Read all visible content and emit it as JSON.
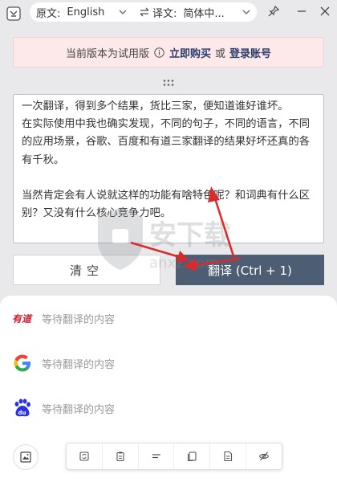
{
  "header": {
    "source_label": "原文:",
    "source_value": "English",
    "target_label": "译文:",
    "target_value": "简体中..."
  },
  "trial": {
    "notice": "当前版本为试用版",
    "buy_link": "立即购买",
    "or": "或",
    "login_link": "登录账号"
  },
  "source_text": "一次翻译，得到多个结果，货比三家，便知道谁好谁坏。\n在实际使用中我也确实发现，不同的句子，不同的语言，不同的应用场景，谷歌、百度和有道三家翻译的结果好坏还真的各有千秋。\n\n当然肯定会有人说就这样的功能有啥特色呢？和词典有什么区别？又没有什么核心竞争力吧。",
  "buttons": {
    "clear": "清空",
    "translate": "翻译 (Ctrl + 1)"
  },
  "results": [
    {
      "engine": "youdao-icon",
      "placeholder": "等待翻译的内容"
    },
    {
      "engine": "google-icon",
      "placeholder": "等待翻译的内容"
    },
    {
      "engine": "baidu-icon",
      "placeholder": "等待翻译的内容"
    }
  ],
  "watermark": "anxz.com",
  "colors": {
    "primary": "#4d5d74",
    "trial_bg": "#fde9e9",
    "link": "#2a3d6b",
    "annotation": "#d92b2b"
  }
}
